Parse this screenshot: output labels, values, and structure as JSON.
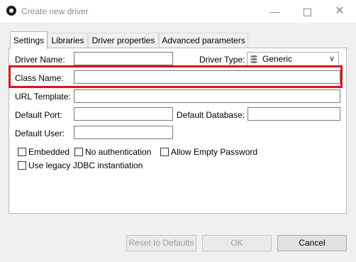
{
  "window": {
    "title": "Create new driver",
    "minimize_glyph": "—",
    "close_glyph": "✕"
  },
  "tabs": [
    {
      "label": "Settings",
      "active": true
    },
    {
      "label": "Libraries",
      "active": false
    },
    {
      "label": "Driver properties",
      "active": false
    },
    {
      "label": "Advanced parameters",
      "active": false
    }
  ],
  "settings": {
    "driver_name": {
      "label": "Driver Name:",
      "value": ""
    },
    "driver_type": {
      "label": "Driver Type:",
      "value": "Generic",
      "icon": "database-icon"
    },
    "class_name": {
      "label": "Class Name:",
      "value": ""
    },
    "url_template": {
      "label": "URL Template:",
      "value": ""
    },
    "default_port": {
      "label": "Default Port:",
      "value": ""
    },
    "default_database": {
      "label": "Default Database:",
      "value": ""
    },
    "default_user": {
      "label": "Default User:",
      "value": ""
    },
    "checkboxes": [
      {
        "label": "Embedded",
        "checked": false
      },
      {
        "label": "No authentication",
        "checked": false
      },
      {
        "label": "Allow Empty Password",
        "checked": false
      },
      {
        "label": "Use legacy JDBC instantiation",
        "checked": false
      }
    ]
  },
  "buttons": {
    "reset": {
      "label": "Reset to Defaults",
      "enabled": false
    },
    "ok": {
      "label": "OK",
      "enabled": false
    },
    "cancel": {
      "label": "Cancel",
      "enabled": true
    }
  },
  "colors": {
    "highlight": "#e0111c",
    "dialog_bg": "#f0f0f0",
    "disabled_text": "#a0a0a0"
  }
}
